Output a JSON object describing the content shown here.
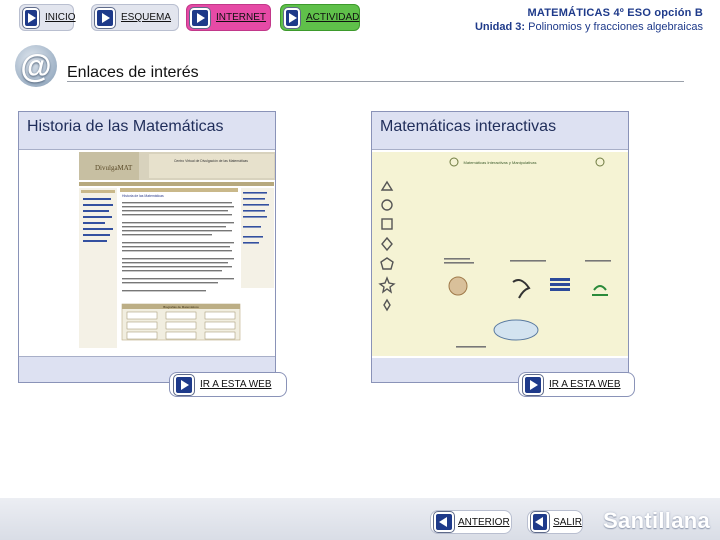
{
  "nav": {
    "inicio": "INICIO",
    "esquema": "ESQUEMA",
    "internet": "INTERNET",
    "actividad": "ACTIVIDAD"
  },
  "header": {
    "title": "MATEMÁTICAS 4º ESO opción B",
    "unit_label": "Unidad 3:",
    "unit_name": "Polinomios y fracciones algebraicas"
  },
  "section": {
    "title": "Enlaces de interés",
    "logo_glyph": "@"
  },
  "cards": [
    {
      "title": "Historia de las Matemáticas",
      "button_label": "IR A ESTA WEB",
      "preview": {
        "site_name": "DivulgaMAT",
        "heading": "Centro Virtual de Divulgación de las Matemáticas",
        "section": "Historia de las Matemáticas",
        "subtitle": "Biografías de Matemáticos"
      }
    },
    {
      "title": "Matemáticas interactivas",
      "button_label": "IR A ESTA WEB",
      "preview": {
        "heading": "Matemáticas Interactivas y Manipulativas"
      }
    }
  ],
  "footer": {
    "anterior": "ANTERIOR",
    "salir": "SALIR",
    "brand": "Santillana"
  },
  "colors": {
    "nav_blue": "#1e3a8a",
    "internet_pink": "#e64aa6",
    "actividad_green": "#5fc04a",
    "card_bg": "#dde1f2"
  }
}
